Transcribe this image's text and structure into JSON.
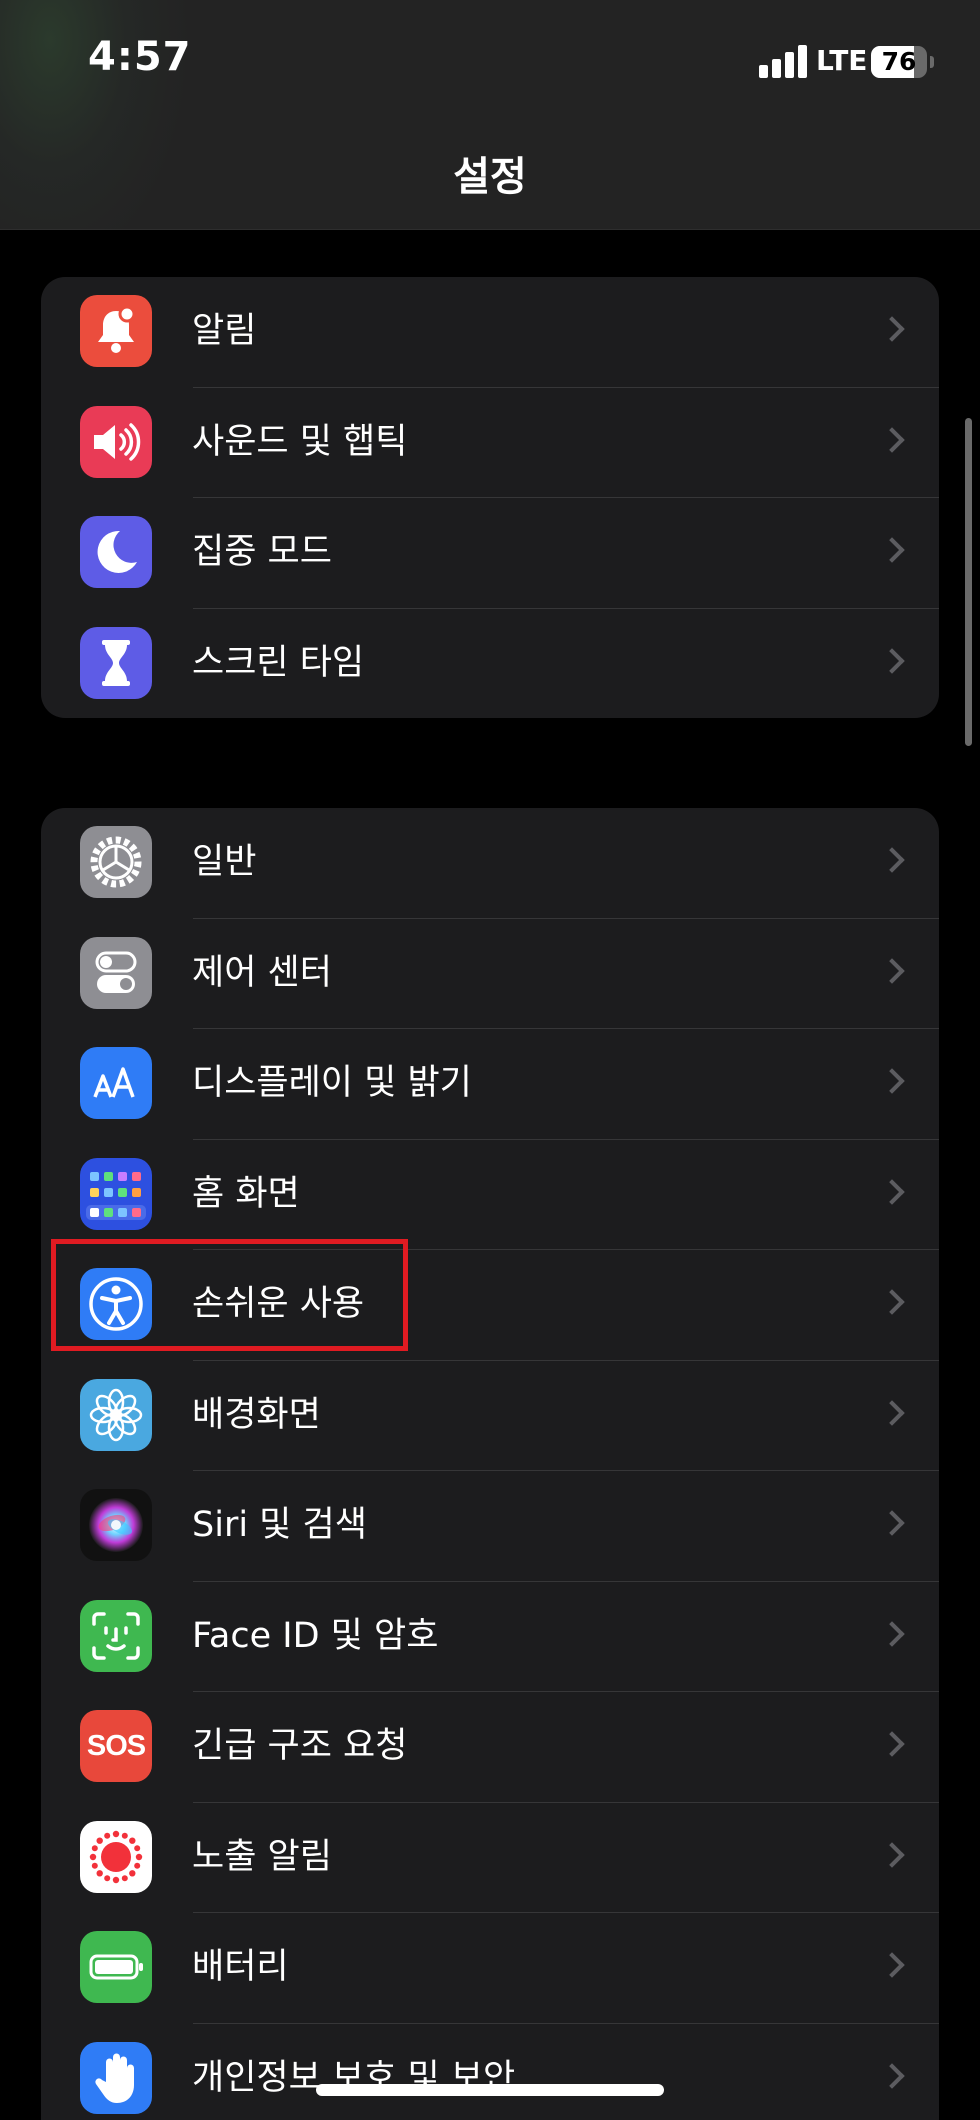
{
  "status_bar": {
    "time": "4:57",
    "network": "LTE",
    "battery_level": "76",
    "battery_fraction": 0.76
  },
  "nav": {
    "title": "설정"
  },
  "groups": [
    {
      "items": [
        {
          "label": "알림",
          "icon": "bell-icon",
          "color": "#EB4D3D"
        },
        {
          "label": "사운드 및 햅틱",
          "icon": "speaker-icon",
          "color": "#E93B56"
        },
        {
          "label": "집중 모드",
          "icon": "moon-icon",
          "color": "#5E5CE6"
        },
        {
          "label": "스크린 타임",
          "icon": "hourglass-icon",
          "color": "#5E5CE6"
        }
      ]
    },
    {
      "items": [
        {
          "label": "일반",
          "icon": "gear-icon",
          "color": "#8E8E93"
        },
        {
          "label": "제어 센터",
          "icon": "toggles-icon",
          "color": "#8E8E93"
        },
        {
          "label": "디스플레이 및 밝기",
          "icon": "text-size-icon",
          "color": "#2F7CF6"
        },
        {
          "label": "홈 화면",
          "icon": "home-grid-icon",
          "color": "#2D50E0"
        },
        {
          "label": "손쉬운 사용",
          "icon": "accessibility-icon",
          "color": "#2F7CF6"
        },
        {
          "label": "배경화면",
          "icon": "flower-icon",
          "color": "#4AA8E0"
        },
        {
          "label": "Siri 및 검색",
          "icon": "siri-icon",
          "color": "#111111"
        },
        {
          "label": "Face ID 및 암호",
          "icon": "face-id-icon",
          "color": "#3FB850"
        },
        {
          "label": "긴급 구조 요청",
          "icon": "sos-icon",
          "sos_text": "SOS",
          "color": "#E8483B"
        },
        {
          "label": "노출 알림",
          "icon": "exposure-icon",
          "color": "#FFFFFF"
        },
        {
          "label": "배터리",
          "icon": "battery-icon",
          "color": "#3FB850"
        },
        {
          "label": "개인정보 보호 및 보안",
          "icon": "hand-icon",
          "color": "#2F7CF6"
        }
      ]
    }
  ]
}
